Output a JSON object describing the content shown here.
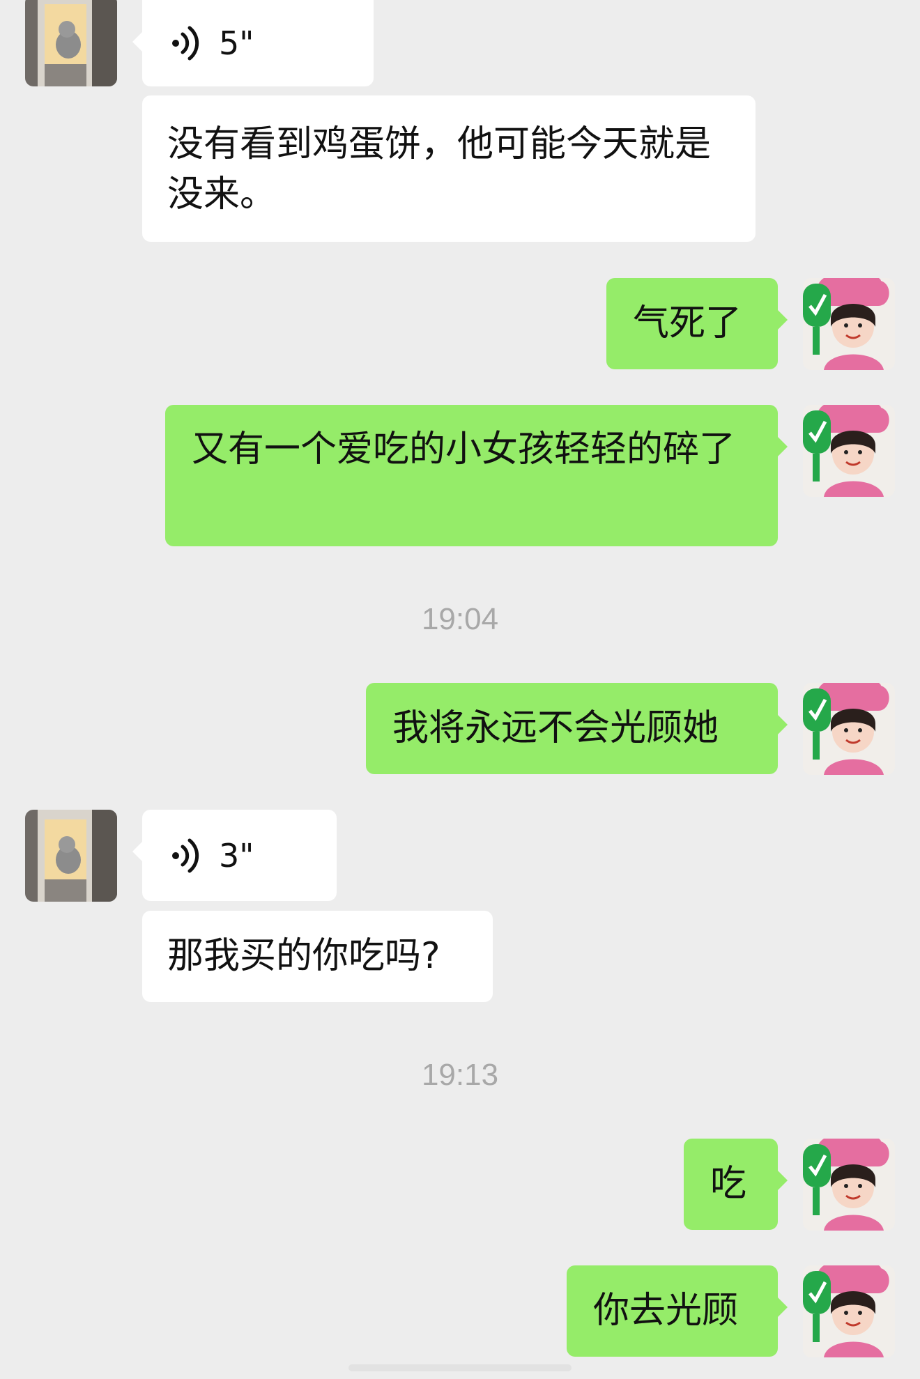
{
  "messages": [
    {
      "side": "in",
      "kind": "voice",
      "duration": "5\""
    },
    {
      "side": "in",
      "kind": "text",
      "text": "没有看到鸡蛋饼，他可能今天就是没来。"
    },
    {
      "side": "out",
      "kind": "text",
      "text": "气死了"
    },
    {
      "side": "out",
      "kind": "text",
      "text": "又有一个爱吃的小女孩轻轻的碎了"
    },
    {
      "kind": "time",
      "text": "19:04"
    },
    {
      "side": "out",
      "kind": "text",
      "text": "我将永远不会光顾她"
    },
    {
      "side": "in",
      "kind": "voice",
      "duration": "3\""
    },
    {
      "side": "in",
      "kind": "text",
      "text": "那我买的你吃吗?"
    },
    {
      "kind": "time",
      "text": "19:13"
    },
    {
      "side": "out",
      "kind": "text",
      "text": "吃"
    },
    {
      "side": "out",
      "kind": "text",
      "text": "你去光顾"
    }
  ],
  "colors": {
    "background": "#ededed",
    "incoming_bubble": "#ffffff",
    "outgoing_bubble": "#95ec69",
    "timestamp": "#a8a8a8"
  },
  "icons": {
    "voice": "voice-wave-icon",
    "contact_avatar": "cat-photo-avatar",
    "own_avatar": "chef-girl-avatar"
  }
}
